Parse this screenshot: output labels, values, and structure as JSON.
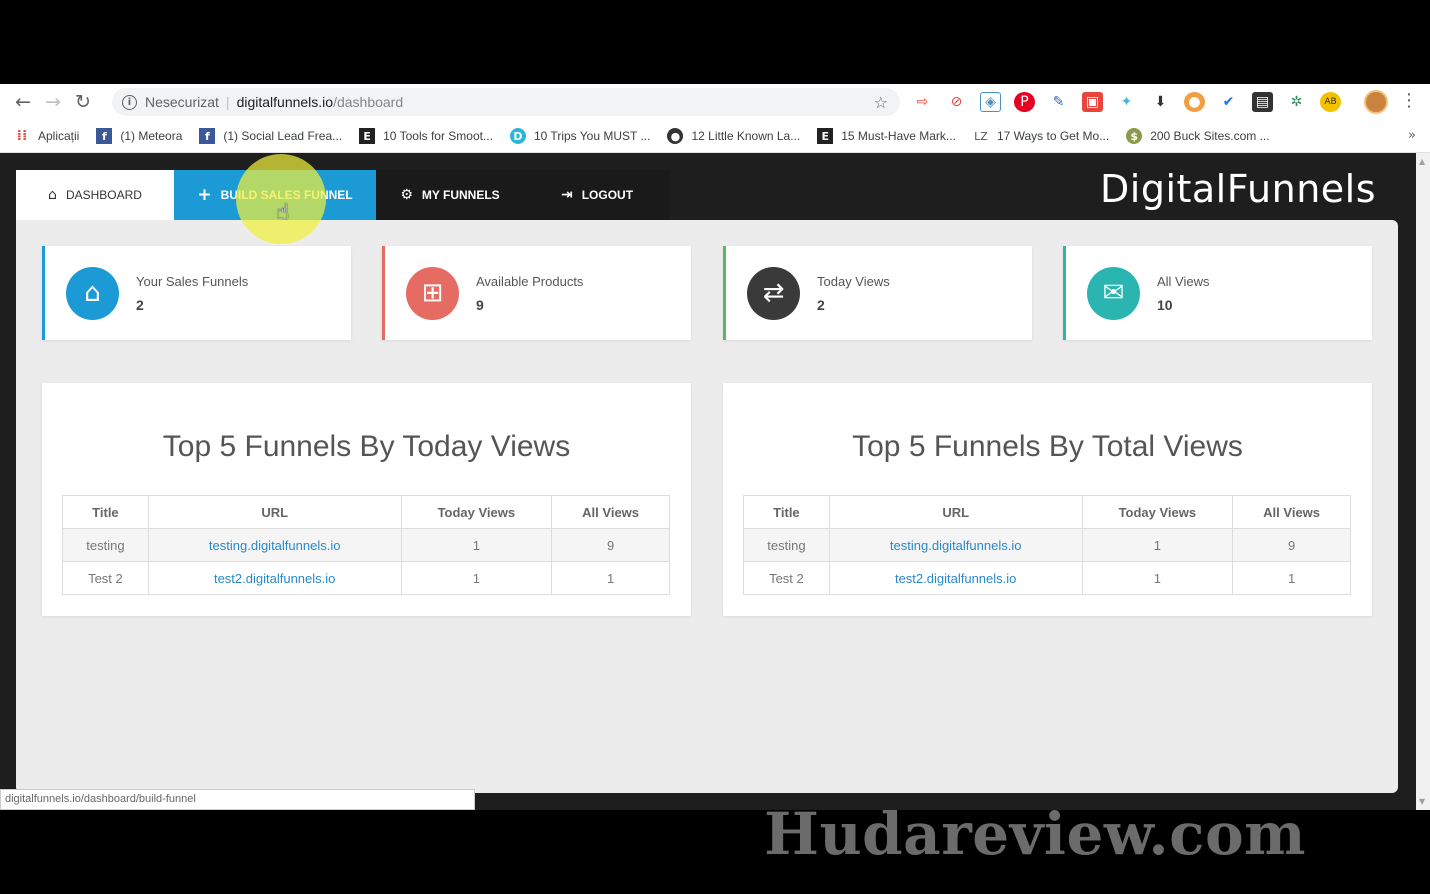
{
  "browser": {
    "omnibox": {
      "security_label": "Nesecurizat",
      "host": "digitalfunnels.io",
      "path": "/dashboard"
    },
    "bookmarks": [
      {
        "icon": "apps-grid-icon",
        "label": "Aplicații"
      },
      {
        "icon": "facebook-icon",
        "label": "(1) Meteora"
      },
      {
        "icon": "facebook-icon",
        "label": "(1) Social Lead Frea..."
      },
      {
        "icon": "letter-e-icon",
        "label": "10 Tools for Smoot..."
      },
      {
        "icon": "letter-d-icon",
        "label": "10 Trips You MUST ..."
      },
      {
        "icon": "circle-logo-icon",
        "label": "12 Little Known La..."
      },
      {
        "icon": "letter-e-icon",
        "label": "15 Must-Have Mark..."
      },
      {
        "icon": "lz-icon",
        "label": "17 Ways to Get Mo..."
      },
      {
        "icon": "buck-icon",
        "label": "200 Buck Sites.com ..."
      }
    ],
    "status_url": "digitalfunnels.io/dashboard/build-funnel"
  },
  "nav": {
    "tabs": [
      {
        "label": "Dashboard",
        "icon": "home-icon"
      },
      {
        "label": "Build Sales Funnel",
        "icon": "plus-icon"
      },
      {
        "label": "My Funnels",
        "icon": "gear-icon"
      },
      {
        "label": "Logout",
        "icon": "sign-out-icon"
      }
    ],
    "brand": "DigitalFunnels"
  },
  "stats": [
    {
      "label": "Your Sales Funnels",
      "value": "2",
      "icon": "home-icon",
      "color": "#1c9ad6"
    },
    {
      "label": "Available Products",
      "value": "9",
      "icon": "gift-icon",
      "color": "#e56b63"
    },
    {
      "label": "Today Views",
      "value": "2",
      "icon": "exchange-icon",
      "color": "#3a3a3a"
    },
    {
      "label": "All Views",
      "value": "10",
      "icon": "envelope-icon",
      "color": "#2bb5b0"
    }
  ],
  "tables": [
    {
      "title": "Top 5 Funnels By Today Views",
      "headers": [
        "Title",
        "URL",
        "Today Views",
        "All Views"
      ],
      "rows": [
        [
          "testing",
          "testing.digitalfunnels.io",
          "1",
          "9"
        ],
        [
          "Test 2",
          "test2.digitalfunnels.io",
          "1",
          "1"
        ]
      ]
    },
    {
      "title": "Top 5 Funnels By Total Views",
      "headers": [
        "Title",
        "URL",
        "Today Views",
        "All Views"
      ],
      "rows": [
        [
          "testing",
          "testing.digitalfunnels.io",
          "1",
          "9"
        ],
        [
          "Test 2",
          "test2.digitalfunnels.io",
          "1",
          "1"
        ]
      ]
    }
  ],
  "watermark": "Hudareview.com",
  "colors": {
    "stat_borders": [
      "#1c9ad6",
      "#e56b63",
      "#5cb85c",
      "#2bb5b0"
    ]
  }
}
